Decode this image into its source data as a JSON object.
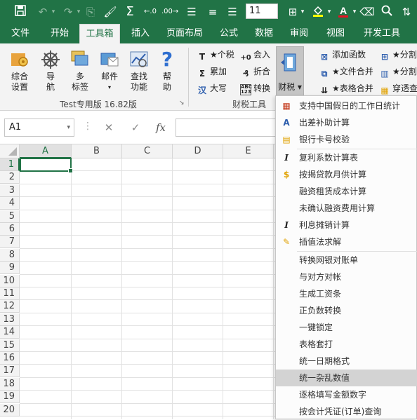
{
  "qat": {
    "font_size": "11"
  },
  "tabs": [
    "文件",
    "开始",
    "工具箱",
    "插入",
    "页面布局",
    "公式",
    "数据",
    "审阅",
    "视图",
    "开发工具"
  ],
  "active_tab": "工具箱",
  "ribbon": {
    "group1": {
      "buttons": [
        {
          "label": "综合\n设置",
          "icon": "gear-settings-icon"
        },
        {
          "label": "导\n航",
          "icon": "helm-wheel-icon"
        },
        {
          "label": "多\n标签",
          "icon": "multi-tab-icon"
        },
        {
          "label": "邮件",
          "icon": "mail-icon"
        },
        {
          "label": "查找\n功能",
          "icon": "find-chart-icon"
        },
        {
          "label": "帮\n助",
          "icon": "help-icon"
        }
      ],
      "label": "Test专用版 16.82版"
    },
    "group2": {
      "items": [
        "★个税",
        "会入",
        "累加",
        "折合",
        "大写",
        "转换"
      ],
      "caishui": "财税",
      "label": "财税工具"
    },
    "group3": {
      "items": [
        "添加函数",
        "★分割",
        "★文件合并",
        "★分割",
        "★表格合并",
        "穿透查"
      ]
    }
  },
  "formula_bar": {
    "name_box": "A1",
    "cancel": "✕",
    "enter": "✓",
    "fx": "fx"
  },
  "grid": {
    "columns": [
      "A",
      "B",
      "C",
      "D",
      "E"
    ],
    "rows": [
      "1",
      "2",
      "3",
      "4",
      "5",
      "6",
      "7",
      "8",
      "9",
      "10",
      "11",
      "12",
      "13",
      "14",
      "15",
      "16",
      "17",
      "18",
      "19",
      "20"
    ],
    "selected": "A1"
  },
  "menu": {
    "items": [
      {
        "label": "支持中国假日的工作日统计",
        "icon": "calendar-icon",
        "color": "#c43b1d"
      },
      {
        "label": "出差补助计算",
        "icon": "letter-a-icon",
        "color": "#2f5fae"
      },
      {
        "label": "银行卡号校验",
        "icon": "card-check-icon",
        "color": "#e0a100"
      },
      {
        "label": "复利系数计算表",
        "icon": "italic-i-icon",
        "color": "#222222"
      },
      {
        "label": "按揭贷款月供计算",
        "icon": "dollar-icon",
        "color": "#e0a100"
      },
      {
        "label": "融资租赁成本计算",
        "icon": "",
        "color": ""
      },
      {
        "label": "未确认融资费用计算",
        "icon": "",
        "color": ""
      },
      {
        "label": "利息摊销计算",
        "icon": "italic-i-icon",
        "color": "#222222"
      },
      {
        "label": "插值法求解",
        "icon": "pencil-icon",
        "color": "#e0a100"
      },
      {
        "label": "转换网银对账单",
        "icon": "",
        "color": ""
      },
      {
        "label": "与对方对帐",
        "icon": "",
        "color": ""
      },
      {
        "label": "生成工资条",
        "icon": "",
        "color": ""
      },
      {
        "label": "正负数转换",
        "icon": "",
        "color": ""
      },
      {
        "label": "一键锁定",
        "icon": "",
        "color": ""
      },
      {
        "label": "表格套打",
        "icon": "",
        "color": ""
      },
      {
        "label": "统一日期格式",
        "icon": "",
        "color": ""
      },
      {
        "label": "统一杂乱数值",
        "icon": "",
        "color": ""
      },
      {
        "label": "逐格填写金额数字",
        "icon": "",
        "color": ""
      },
      {
        "label": "按会计凭证(订单)查询",
        "icon": "",
        "color": ""
      }
    ],
    "highlighted": "统一杂乱数值"
  },
  "colors": {
    "accent": "#217346",
    "menu_highlight": "#d3d3d3"
  }
}
